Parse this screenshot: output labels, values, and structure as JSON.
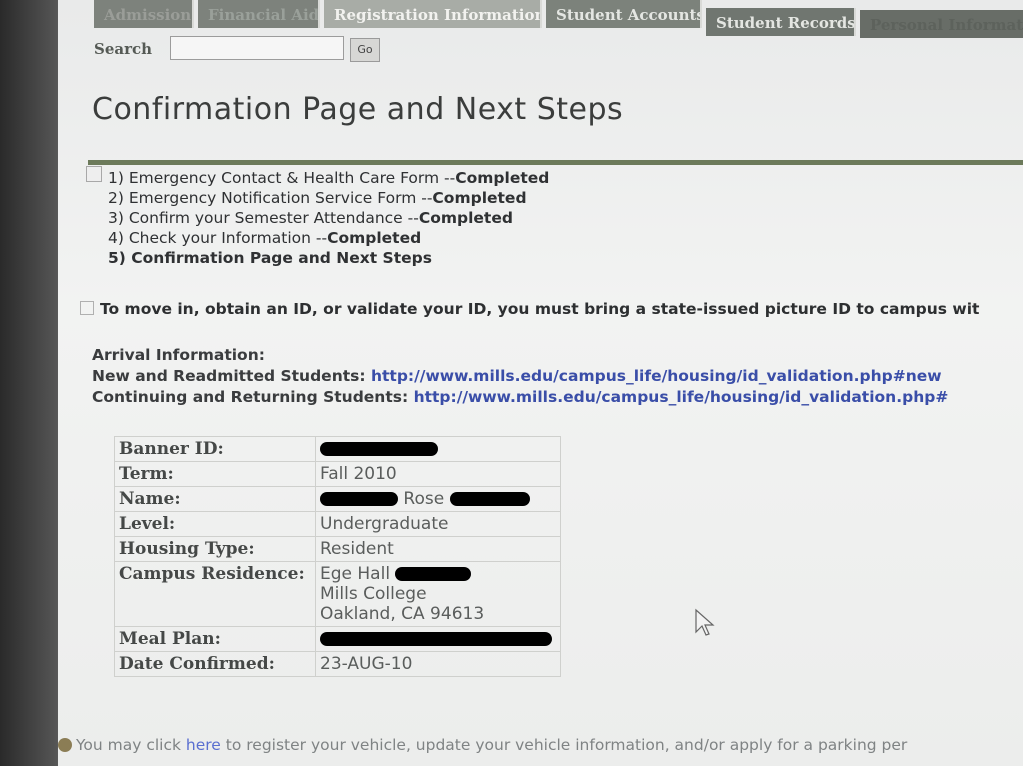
{
  "tabs": [
    "Admission",
    "Financial Aid",
    "Registration Information",
    "Student Accounts",
    "Student Records",
    "Personal Information"
  ],
  "search": {
    "label": "Search",
    "go_label": "Go"
  },
  "page_title": "Confirmation Page and Next Steps",
  "steps": [
    {
      "text": "1) Emergency Contact & Health Care Form --",
      "status": "Completed"
    },
    {
      "text": "2) Emergency Notification Service Form --",
      "status": "Completed"
    },
    {
      "text": "3) Confirm your Semester Attendance --",
      "status": "Completed"
    },
    {
      "text": "4) Check your Information --",
      "status": "Completed"
    },
    {
      "text": "5) Confirmation Page and Next Steps",
      "status": ""
    }
  ],
  "notice": "To move in, obtain an ID, or validate your ID, you must bring a state-issued picture ID to campus wit",
  "arrival": {
    "heading": "Arrival Information:",
    "new_label": "New and Readmitted Students:",
    "new_url": "http://www.mills.edu/campus_life/housing/id_validation.php#new",
    "cont_label": "Continuing and Returning Students:",
    "cont_url": "http://www.mills.edu/campus_life/housing/id_validation.php#"
  },
  "info": {
    "banner_id_label": "Banner ID:",
    "term_label": "Term:",
    "term_value": "Fall 2010",
    "name_label": "Name:",
    "name_value": "Rose",
    "level_label": "Level:",
    "level_value": "Undergraduate",
    "housing_label": "Housing Type:",
    "housing_value": "Resident",
    "residence_label": "Campus Residence:",
    "residence_line1": "Ege Hall",
    "residence_line2": "Mills College",
    "residence_line3": "Oakland, CA 94613",
    "meal_label": "Meal Plan:",
    "date_label": "Date Confirmed:",
    "date_value": "23-AUG-10"
  },
  "footer": {
    "pre": "You may click ",
    "link": "here",
    "post": " to register your vehicle, update your vehicle information, and/or apply for a parking per"
  }
}
